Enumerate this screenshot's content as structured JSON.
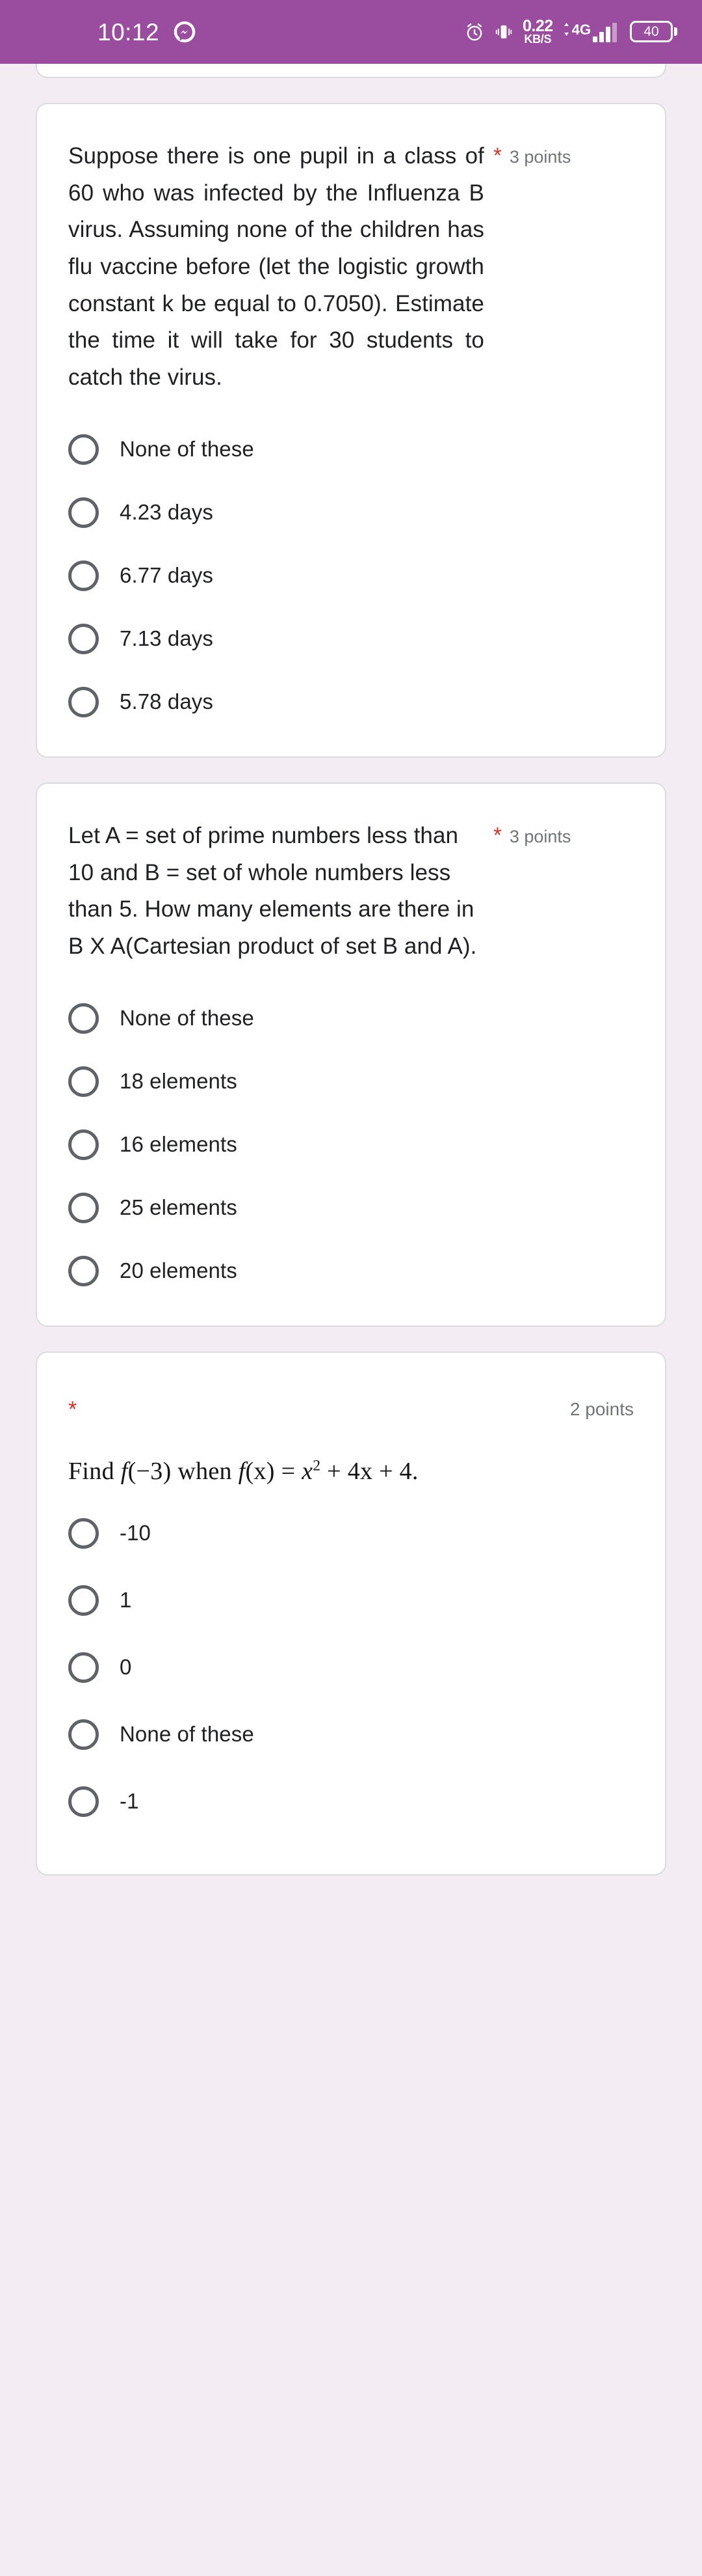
{
  "status_bar": {
    "time": "10:12",
    "messenger_icon": "messenger-icon",
    "alarm_icon": "alarm-icon",
    "vibrate_icon": "vibrate-icon",
    "network_speed_value": "0.22",
    "network_speed_unit": "KB/S",
    "network_type": "4G",
    "battery_level": "40",
    "background_color": "#9a4d9e"
  },
  "theme": {
    "page_background": "#f3ecf3",
    "card_background": "#ffffff",
    "card_border": "#dadce0",
    "required_star_color": "#d93025",
    "points_text_color": "#70757a",
    "radio_border_color": "#5f6368",
    "text_color": "#202124"
  },
  "questions": [
    {
      "id": "q1",
      "text": "Suppose there is one pupil in a class of 60 who was infected by the Influenza B virus. Assuming none of the children has flu vaccine before (let the logistic growth constant k be equal to 0.7050). Estimate the time it will take for 30 students to catch the virus.",
      "required_star": "*",
      "points": "3 points",
      "options": [
        "None of these",
        "4.23 days",
        "6.77 days",
        "7.13 days",
        "5.78 days"
      ],
      "selected": null
    },
    {
      "id": "q2",
      "text": "Let A = set of prime numbers less than 10 and  B = set of whole numbers less than 5. How many elements are there in B X A(Cartesian product of set B and A).",
      "required_star": "*",
      "points": "3 points",
      "options": [
        "None of these",
        "18 elements",
        "16 elements",
        "25 elements",
        "20 elements"
      ],
      "selected": null
    },
    {
      "id": "q3",
      "required_star": "*",
      "points": "2 points",
      "formula_plain": "Find f(-3) when f(x) = x² + 4x + 4.",
      "formula_parts": {
        "lead": "Find",
        "fn_f": "f",
        "arg": "(−3)",
        "when": "when",
        "fx": "f",
        "fx_arg": "(x)",
        "eq": "=",
        "x": "x",
        "exp": "2",
        "tail": "+ 4x + 4."
      },
      "options": [
        "-10",
        "1",
        "0",
        "None of these",
        "-1"
      ],
      "selected": null
    }
  ]
}
